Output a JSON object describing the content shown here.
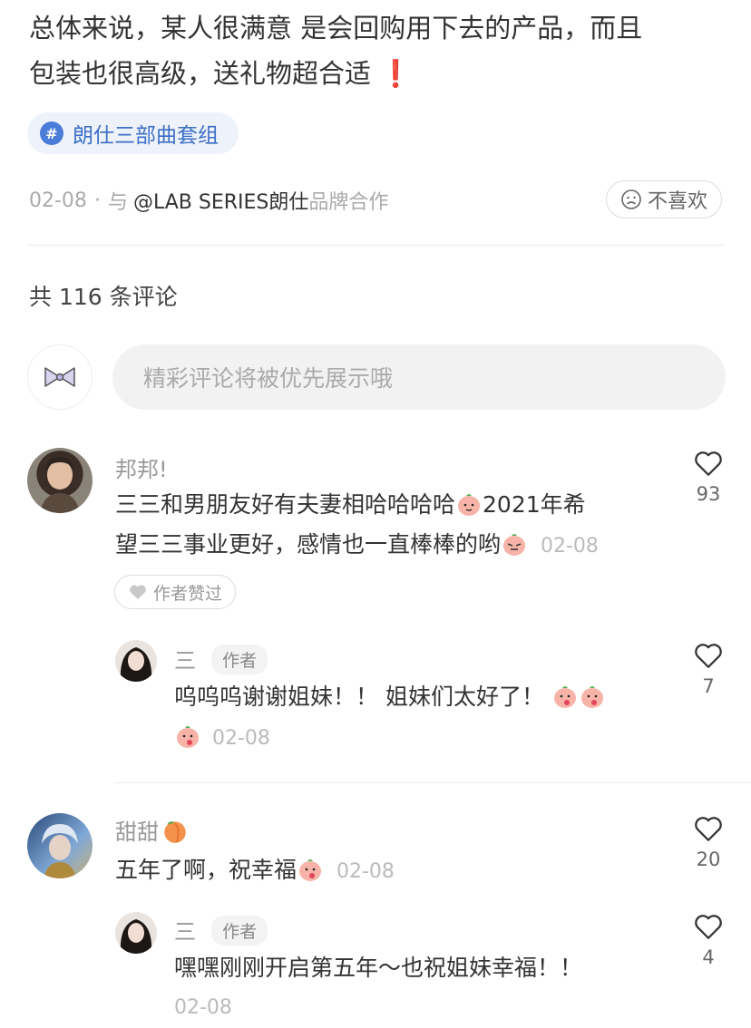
{
  "post": {
    "body_line1": "总体来说，某人很满意 是会回购用下去的产品，而且",
    "body_line2": "包装也很高级，送礼物超合适",
    "exclamation": "❗",
    "hashtag": "朗仕三部曲套组",
    "date": "02-08",
    "dot": "·",
    "with": "与",
    "brand": "@LAB SERIES朗仕",
    "collab": "品牌合作",
    "dislike_label": "不喜欢"
  },
  "comments_header": {
    "count_text": "共 116 条评论",
    "input_placeholder": "精彩评论将被优先展示哦"
  },
  "comments": [
    {
      "user": "邦邦!",
      "text_line1": "三三和男朋友好有夫妻相哈哈哈哈",
      "text_line1b": "2021年希",
      "text_line2": "望三三事业更好，感情也一直棒棒的哟",
      "time": "02-08",
      "likes": "93",
      "author_liked": "作者赞过"
    },
    {
      "user": "三",
      "tag": "作者",
      "text": "呜呜呜谢谢姐妹！！ 姐妹们太好了！",
      "time": "02-08",
      "likes": "7"
    },
    {
      "user": "甜甜",
      "text": "五年了啊，祝幸福",
      "time": "02-08",
      "likes": "20"
    },
    {
      "user": "三",
      "tag": "作者",
      "text": "嘿嘿刚刚开启第五年～也祝姐妹幸福！！",
      "time": "02-08",
      "likes": "4"
    }
  ],
  "icons": {
    "hashtag": "hashtag-icon",
    "dislike": "sad-face-icon",
    "like": "heart-outline-icon",
    "author_like": "heart-filled-icon",
    "emoji": "peach-emoji-icon"
  },
  "colors": {
    "accent_blue": "#3d6fc8",
    "muted_text": "#999999",
    "exclamation_red": "#e02020"
  }
}
